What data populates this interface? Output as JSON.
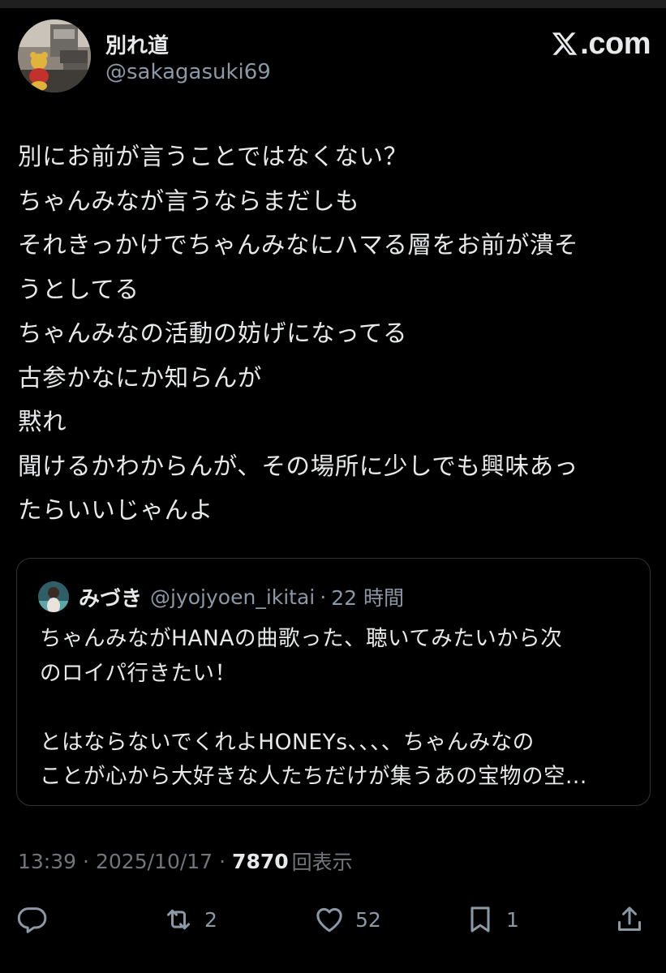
{
  "author": {
    "name": "別れ道",
    "handle": "@sakagasuki69"
  },
  "brand": {
    "label": ".com",
    "icon": "x-logo-icon"
  },
  "tweet": {
    "lines": [
      "別にお前が言うことではなくない？",
      "ちゃんみなが言うならまだしも",
      "それきっかけでちゃんみなにハマる層をお前が潰そ",
      "うとしてる",
      "ちゃんみなの活動の妨げになってる",
      "古参かなにか知らんが",
      "黙れ",
      "聞けるかわからんが、その場所に少しでも興味あっ",
      "たらいいじゃんよ"
    ]
  },
  "quote": {
    "name": "みづき",
    "handle": "@jyojyoen_ikitai",
    "separator": "·",
    "time": "22 時間",
    "lines": [
      "ちゃんみながHANAの曲歌った、聴いてみたいから次",
      "のロイパ行きたい！",
      "",
      "とはならないでくれよHONEYs、、、、ちゃんみなの",
      "ことが心から大好きな人たちだけが集うあの宝物の空..."
    ]
  },
  "meta": {
    "time": "13:39",
    "sep1": "·",
    "date": "2025/10/17",
    "sep2": "·",
    "views": "7870",
    "views_label": "回表示"
  },
  "actions": {
    "reply": {
      "icon": "reply-icon",
      "count": ""
    },
    "repost": {
      "icon": "repost-icon",
      "count": "2"
    },
    "like": {
      "icon": "heart-icon",
      "count": "52"
    },
    "bookmark": {
      "icon": "bookmark-icon",
      "count": "1"
    },
    "share": {
      "icon": "share-icon",
      "count": ""
    }
  },
  "colors": {
    "background": "#000000",
    "text": "#e7e9ea",
    "secondary": "#8b98a5",
    "border": "#2f3336"
  }
}
